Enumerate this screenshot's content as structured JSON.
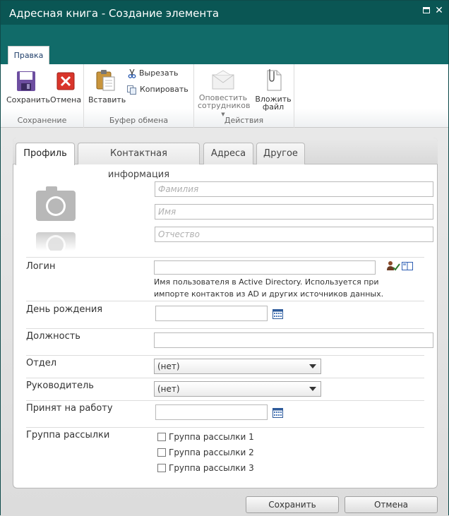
{
  "window": {
    "title": "Адресная книга - Создание элемента"
  },
  "ribbon": {
    "tab": "Правка",
    "groups": {
      "save": {
        "label": "Сохранение",
        "save": "Сохранить",
        "cancel": "Отмена"
      },
      "clipboard": {
        "label": "Буфер обмена",
        "paste": "Вставить",
        "cut": "Вырезать",
        "copy": "Копировать"
      },
      "actions": {
        "label": "Действия",
        "notify_line1": "Оповестить",
        "notify_line2": "сотрудников",
        "attach_line1": "Вложить",
        "attach_line2": "файл"
      }
    }
  },
  "tabs": [
    "Профиль",
    "Контактная информация",
    "Адреса",
    "Другое"
  ],
  "profile": {
    "lastname_placeholder": "Фамилия",
    "firstname_placeholder": "Имя",
    "middlename_placeholder": "Отчество"
  },
  "fields": {
    "login": {
      "label": "Логин",
      "value": "",
      "hint": "Имя пользователя в Active Directory. Используется при импорте контактов из AD и других источников данных."
    },
    "birthday": {
      "label": "День рождения",
      "value": ""
    },
    "position": {
      "label": "Должность",
      "value": ""
    },
    "department": {
      "label": "Отдел",
      "value": "(нет)"
    },
    "manager": {
      "label": "Руководитель",
      "value": "(нет)"
    },
    "hired": {
      "label": "Принят на работу",
      "value": ""
    },
    "mailing": {
      "label": "Группа рассылки",
      "options": [
        {
          "label": "Группа рассылки 1",
          "checked": false
        },
        {
          "label": "Группа рассылки 2",
          "checked": false
        },
        {
          "label": "Группа рассылки 3",
          "checked": false
        }
      ]
    }
  },
  "footer": {
    "save": "Сохранить",
    "cancel": "Отмена"
  },
  "colors": {
    "titlebar": "#0a5654",
    "ribbon_band": "#116b69",
    "text": "#333333"
  }
}
